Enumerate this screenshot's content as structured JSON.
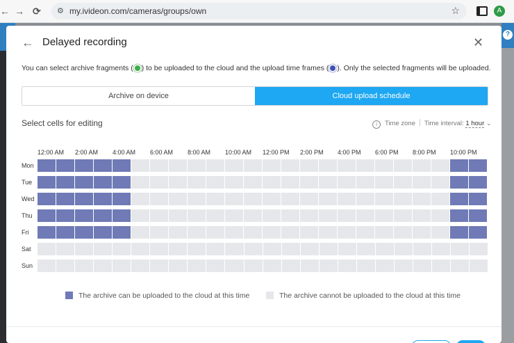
{
  "browser": {
    "back": "←",
    "forward": "→",
    "reload": "⟳",
    "url": "my.ivideon.com/cameras/groups/own",
    "avatar_letter": "A"
  },
  "modal": {
    "title": "Delayed recording",
    "description_part1": "You can select archive fragments (",
    "description_part2": ") to be uploaded to the cloud and the upload time frames (",
    "description_part3": "). Only the selected fragments will be uploaded.",
    "tabs": [
      {
        "label": "Archive on device",
        "active": false
      },
      {
        "label": "Cloud upload schedule",
        "active": true
      }
    ],
    "select_cells_label": "Select cells for editing",
    "time_zone_label": "Time zone",
    "time_interval_label": "Time interval:",
    "time_interval_value": "1 hour",
    "time_labels": [
      "12:00 AM",
      "2:00 AM",
      "4:00 AM",
      "6:00 AM",
      "8:00 AM",
      "10:00 AM",
      "12:00 PM",
      "2:00 PM",
      "4:00 PM",
      "6:00 PM",
      "8:00 PM",
      "10:00 PM"
    ],
    "days": [
      {
        "label": "Mon",
        "selected_hours": [
          0,
          1,
          2,
          3,
          4,
          22,
          23
        ]
      },
      {
        "label": "Tue",
        "selected_hours": [
          0,
          1,
          2,
          3,
          4,
          22,
          23
        ]
      },
      {
        "label": "Wed",
        "selected_hours": [
          0,
          1,
          2,
          3,
          4,
          22,
          23
        ]
      },
      {
        "label": "Thu",
        "selected_hours": [
          0,
          1,
          2,
          3,
          4,
          22,
          23
        ]
      },
      {
        "label": "Fri",
        "selected_hours": [
          0,
          1,
          2,
          3,
          4,
          22,
          23
        ]
      },
      {
        "label": "Sat",
        "selected_hours": []
      },
      {
        "label": "Sun",
        "selected_hours": []
      }
    ],
    "legend_on": "The archive can be uploaded to the cloud at this time",
    "legend_off": "The archive cannot be uploaded to the cloud at this time"
  },
  "colors": {
    "accent": "#1ea7f2",
    "selected_cell": "#6f7ab6",
    "empty_cell": "#e6e7ea"
  }
}
